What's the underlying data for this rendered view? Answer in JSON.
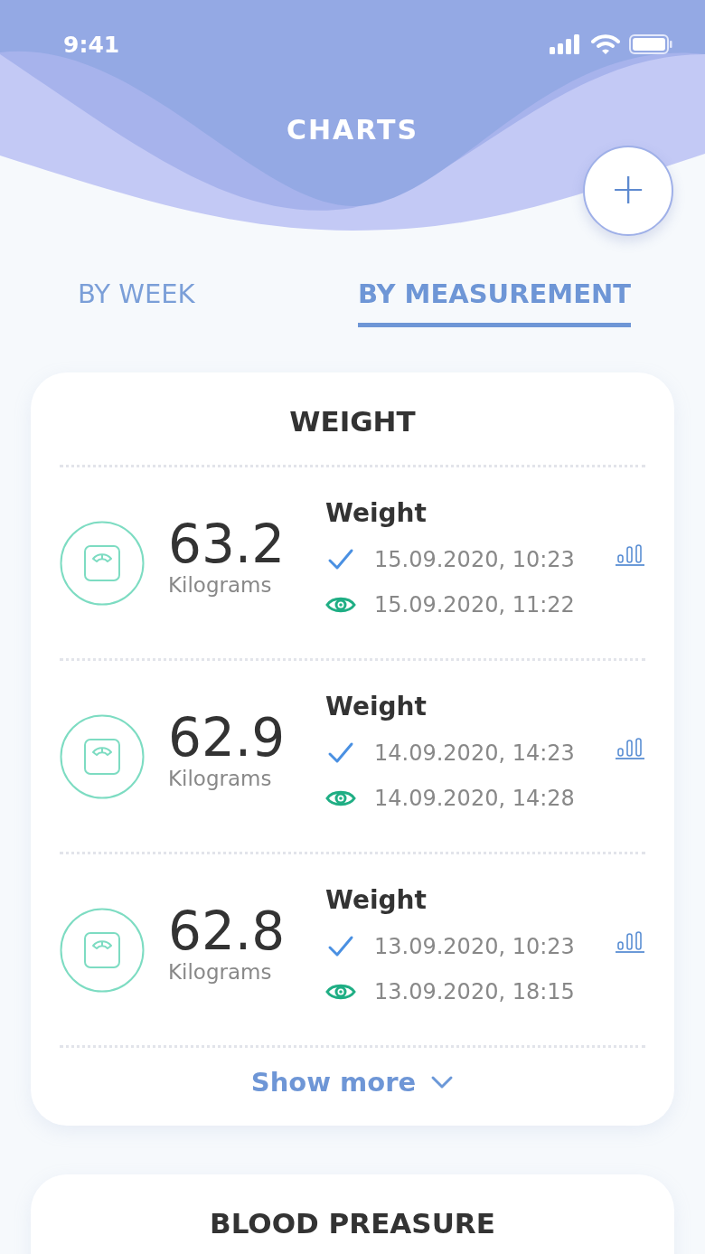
{
  "status_bar": {
    "time": "9:41"
  },
  "header": {
    "title": "CHARTS",
    "add_button": "+"
  },
  "tabs": [
    {
      "label": "BY WEEK",
      "selected": false
    },
    {
      "label": "BY MEASUREMENT",
      "selected": true
    }
  ],
  "cards": [
    {
      "title": "WEIGHT",
      "rows": [
        {
          "value": "63.2",
          "unit": "Kilograms",
          "name": "Weight",
          "entries": [
            {
              "kind": "check",
              "text": "15.09.2020, 10:23"
            },
            {
              "kind": "seen",
              "text": "15.09.2020, 11:22"
            }
          ]
        },
        {
          "value": "62.9",
          "unit": "Kilograms",
          "name": "Weight",
          "entries": [
            {
              "kind": "check",
              "text": "14.09.2020, 14:23"
            },
            {
              "kind": "seen",
              "text": "14.09.2020, 14:28"
            }
          ]
        },
        {
          "value": "62.8",
          "unit": "Kilograms",
          "name": "Weight",
          "entries": [
            {
              "kind": "check",
              "text": "13.09.2020, 10:23"
            },
            {
              "kind": "seen",
              "text": "13.09.2020, 18:15"
            }
          ]
        }
      ],
      "show_more": "Show more"
    },
    {
      "title": "BLOOD PREASURE"
    }
  ]
}
